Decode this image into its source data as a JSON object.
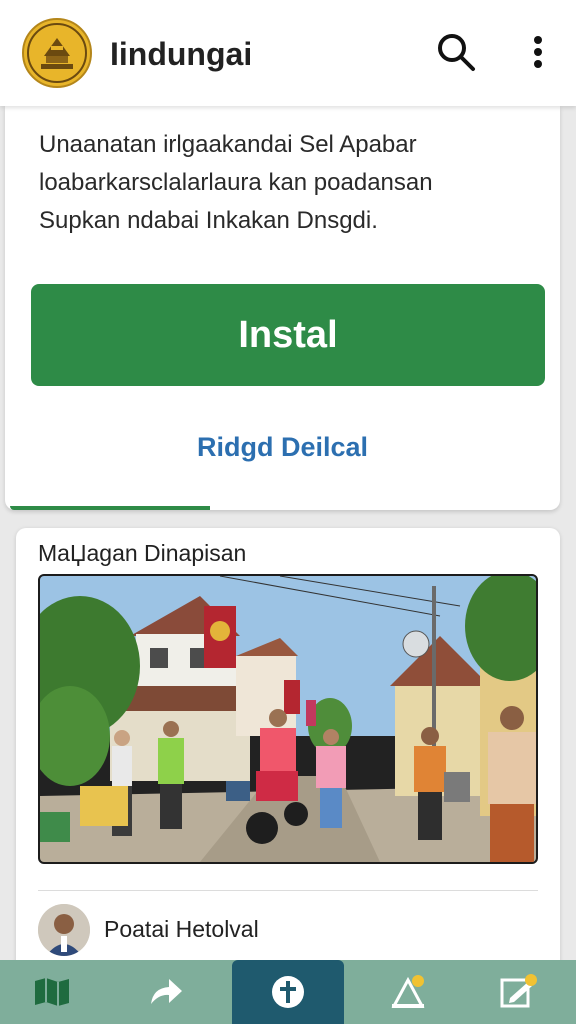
{
  "app": {
    "title": "Iindungai"
  },
  "install_card": {
    "description_lines": [
      "Unaanatan irlgaakandai Sel Apabar",
      "loabarkarsclalarlaura kan poadansan",
      "Supkan ndabai Inkakan Dnsgdi."
    ],
    "install_label": "Instal",
    "secondary_label": "Ridgd Deilcal"
  },
  "news_card": {
    "heading": "MaЏagan Dinapisan",
    "author_name": "Poatai Hetolval"
  },
  "bottom_nav": {
    "items": [
      "map-icon",
      "share-icon",
      "add-icon",
      "alert-icon",
      "edit-icon"
    ]
  },
  "colors": {
    "primary_green": "#2e8b47",
    "link_blue": "#2c6fb0",
    "nav_bg": "#7fae9b",
    "nav_active": "#1f5a6e",
    "logo_gold": "#e8b52a"
  }
}
